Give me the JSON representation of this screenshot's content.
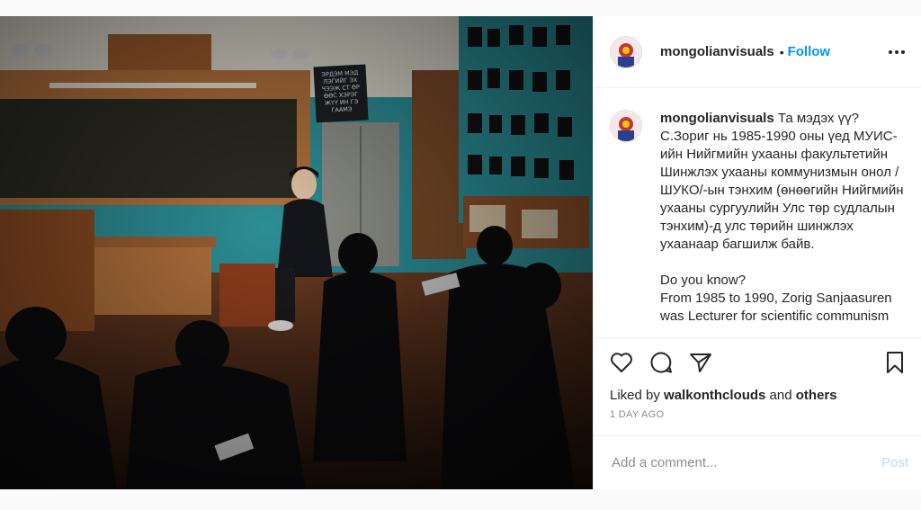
{
  "post": {
    "username": "mongolianvisuals",
    "follow_label": "Follow",
    "caption": "Та мэдэх үү? С.Зориг нь 1985-1990 оны үед МУИС-ийн Нийгмийн ухааны факультетийн Шинжлэх ухааны коммунизмын онол /ШУКО/-ын тэнхим (өнөөгийн Нийгмийн ухааны сургуулийн Улс төр судлалын тэнхим)-д улс төрийн шинжлэх ухаанаар багшилж байв.\n\nDo you know?\nFrom 1985 to 1990, Zorig Sanjaasuren was Lecturer for scientific communism",
    "liked_by_prefix": "Liked by ",
    "liked_by_user": "walkonthclouds",
    "liked_by_and": " and ",
    "liked_by_others": "others",
    "timestamp": "1 DAY AGO",
    "comment_placeholder": "Add a comment...",
    "post_label": "Post"
  },
  "photo": {
    "board_sign_text": "Эрдэм мэд\nлэгийг эх\nчээж ст өр\nөөс хэрэг\nжүү ин гэ\nгаамэ"
  },
  "icons": {
    "like": "heart-icon",
    "comment": "comment-icon",
    "share": "paper-plane-icon",
    "save": "bookmark-icon",
    "more": "more-options-icon"
  },
  "colors": {
    "accent": "#0095f6",
    "post_disabled": "#b2dffc",
    "text": "#262626",
    "muted": "#8e8e8e"
  }
}
